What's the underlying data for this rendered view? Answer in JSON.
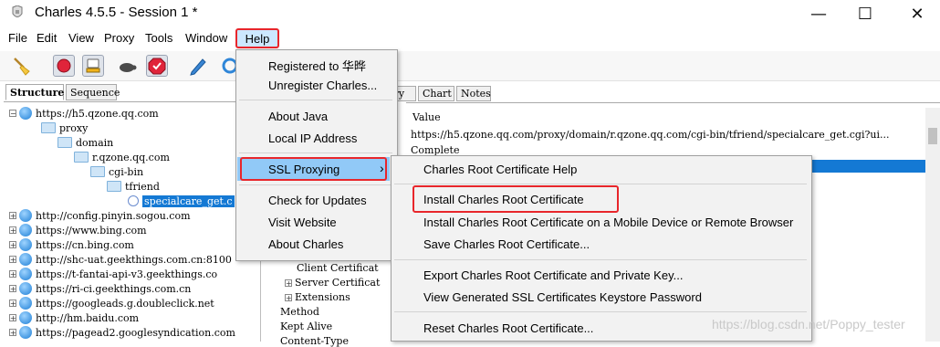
{
  "window": {
    "title": "Charles 4.5.5 - Session 1 *",
    "controls": {
      "minimize": "—",
      "maximize": "☐",
      "close": "✕"
    }
  },
  "menubar": {
    "items": [
      "File",
      "Edit",
      "View",
      "Proxy",
      "Tools",
      "Window",
      "Help"
    ],
    "active": "Help"
  },
  "toolbar": {
    "icons": [
      "broom-icon",
      "record-icon",
      "throttle-icon",
      "turtle-icon",
      "breakpoint-icon",
      "compose-pen-icon",
      "refresh-icon"
    ]
  },
  "left_pane": {
    "tabs": [
      "Structure",
      "Sequence"
    ],
    "active_tab": "Structure",
    "tree": [
      {
        "label": "https://h5.qzone.qq.com",
        "kind": "globe",
        "expander": "−"
      },
      {
        "label": "proxy",
        "kind": "folder"
      },
      {
        "label": "domain",
        "kind": "folder"
      },
      {
        "label": "r.qzone.qq.com",
        "kind": "folder"
      },
      {
        "label": "cgi-bin",
        "kind": "folder"
      },
      {
        "label": "tfriend",
        "kind": "folder"
      },
      {
        "label": "specialcare_get.c",
        "kind": "file",
        "selected": true
      },
      {
        "label": "http://config.pinyin.sogou.com",
        "kind": "globe",
        "expander": "+"
      },
      {
        "label": "https://www.bing.com",
        "kind": "globe",
        "expander": "+"
      },
      {
        "label": "https://cn.bing.com",
        "kind": "globe",
        "expander": "+"
      },
      {
        "label": "http://shc-uat.geekthings.com.cn:8100",
        "kind": "globe",
        "expander": "+"
      },
      {
        "label": "https://t-fantai-api-v3.geekthings.co",
        "kind": "globe",
        "expander": "+"
      },
      {
        "label": "https://ri-ci.geekthings.com.cn",
        "kind": "globe",
        "expander": "+"
      },
      {
        "label": "https://googleads.g.doubleclick.net",
        "kind": "globe",
        "expander": "+"
      },
      {
        "label": "http://hm.baidu.com",
        "kind": "globe",
        "expander": "+"
      },
      {
        "label": "https://pagead2.googlesyndication.com",
        "kind": "globe",
        "expander": "+"
      }
    ]
  },
  "right_pane": {
    "tabs": [
      "ary",
      "Chart",
      "Notes"
    ],
    "column_header": "Value",
    "rows": [
      "https://h5.qzone.qq.com/proxy/domain/r.qzone.qq.com/cgi-bin/tfriend/specialcare_get.cgi?ui...",
      "Complete"
    ],
    "detail_items": [
      "Client Certificat",
      "Server Certificat",
      "Extensions",
      "Method",
      "Kept Alive",
      "Content-Type"
    ]
  },
  "help_menu": {
    "items": [
      "Registered to 华晔",
      "Unregister Charles...",
      "About Java",
      "Local IP Address",
      "SSL Proxying",
      "Check for Updates",
      "Visit Website",
      "About Charles"
    ],
    "highlighted": "SSL Proxying",
    "submenu_arrow": "›"
  },
  "ssl_submenu": {
    "items": [
      "Charles Root Certificate Help",
      "Install Charles Root Certificate",
      "Install Charles Root Certificate on a Mobile Device or Remote Browser",
      "Save Charles Root Certificate...",
      "Export Charles Root Certificate and Private Key...",
      "View Generated SSL Certificates Keystore Password",
      "Reset Charles Root Certificate..."
    ],
    "outlined": "Install Charles Root Certificate"
  },
  "watermark": "https://blog.csdn.net/Poppy_tester",
  "colors": {
    "accent_outline": "#e8262b",
    "selection": "#1479d4",
    "menu_highlight": "#91c9f7",
    "menubar_highlight": "#cce8ff"
  }
}
